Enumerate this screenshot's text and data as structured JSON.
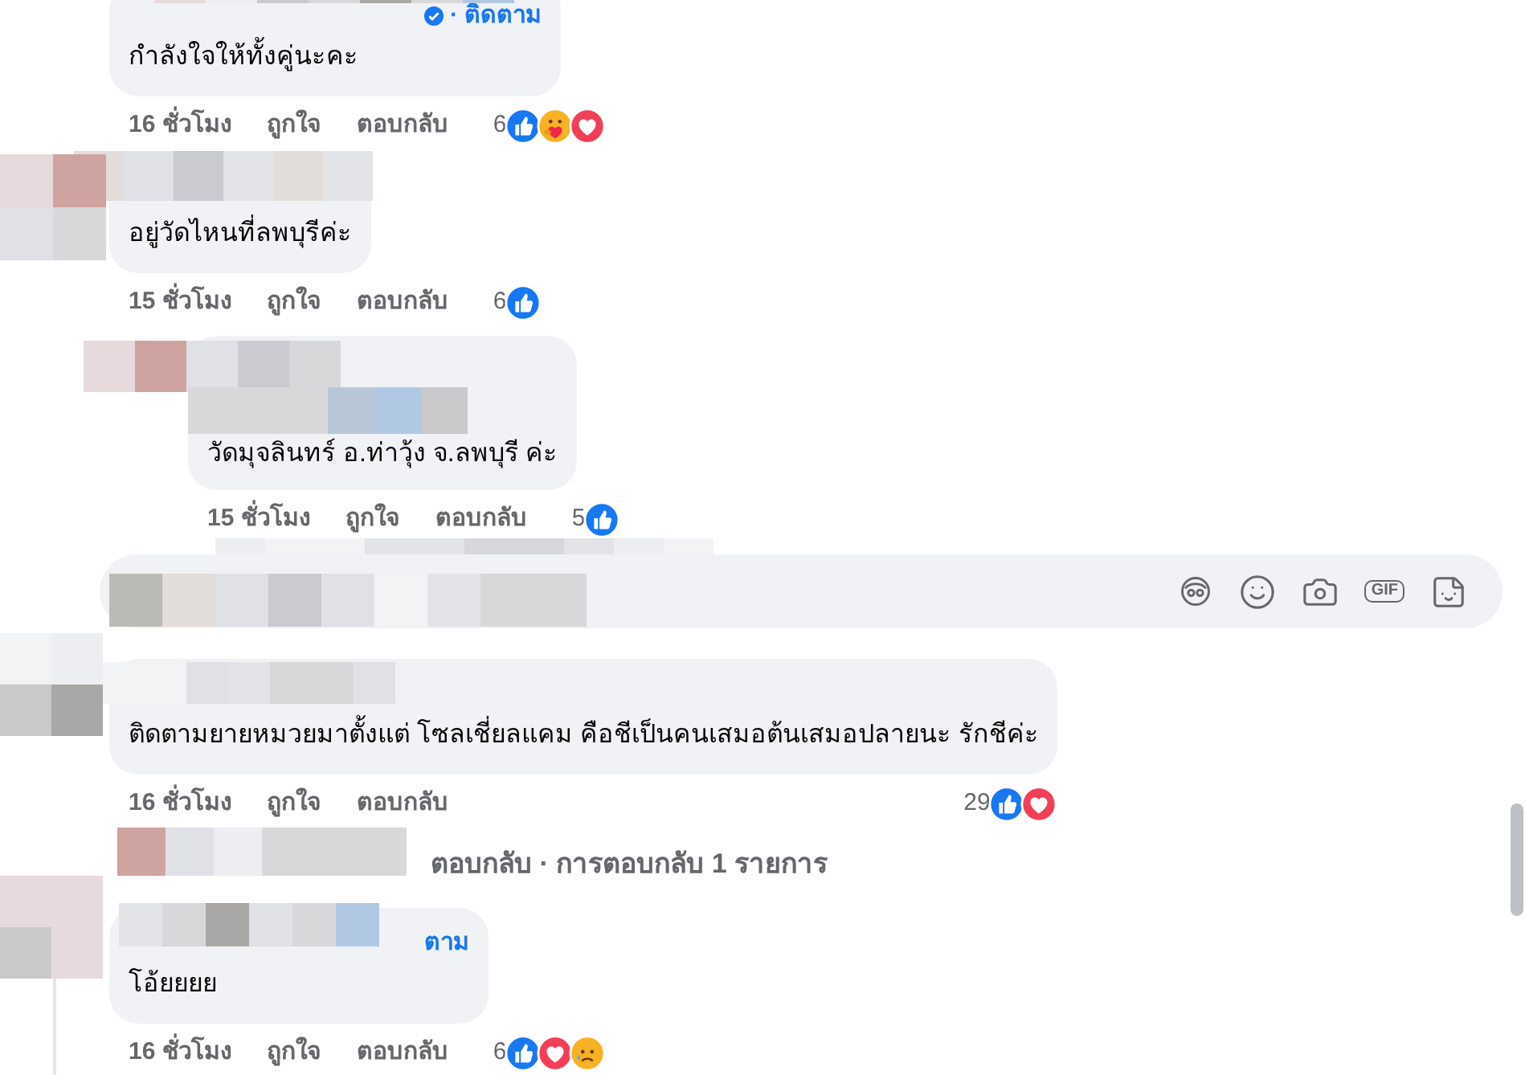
{
  "thread": [
    {
      "kind": "comment",
      "indent": false,
      "header": "· ติดตาม",
      "verified": true,
      "text": "กำลังใจให้ทั้งคู่นะคะ",
      "time": "16 ชั่วโมง",
      "like": "ถูกใจ",
      "reply": "ตอบกลับ",
      "count": "6",
      "reactions": [
        {
          "kind": "like"
        },
        {
          "kind": "care"
        },
        {
          "kind": "love"
        }
      ]
    },
    {
      "kind": "comment",
      "indent": false,
      "text": "อยู่วัดไหนที่ลพบุรีค่ะ",
      "time": "15 ชั่วโมง",
      "like": "ถูกใจ",
      "reply": "ตอบกลับ",
      "count": "6",
      "reactions": [
        {
          "kind": "like"
        }
      ]
    },
    {
      "kind": "comment",
      "indent": true,
      "text": "วัดมุจลินทร์ อ.ท่าวุ้ง จ.ลพบุรี ค่ะ",
      "time": "15 ชั่วโมง",
      "like": "ถูกใจ",
      "reply": "ตอบกลับ",
      "count": "5",
      "reactions": [
        {
          "kind": "like"
        }
      ]
    },
    {
      "kind": "composer",
      "gif_label": "GIF"
    },
    {
      "kind": "comment",
      "indent": false,
      "text": "ติดตามยายหมวยมาตั้งแต่ โซลเชี่ยลแคม คือชีเป็นคนเสมอต้นเสมอปลายนะ รักชีค่ะ",
      "time": "16 ชั่วโมง",
      "like": "ถูกใจ",
      "reply": "ตอบกลับ",
      "count": "29",
      "reactions": [
        {
          "kind": "like"
        },
        {
          "kind": "love"
        }
      ]
    },
    {
      "kind": "replies_link",
      "text": "ตอบกลับ · การตอบกลับ 1 รายการ"
    },
    {
      "kind": "comment",
      "indent": false,
      "header": "ตาม",
      "verified": false,
      "text": "โอ้ยยยย",
      "time": "16 ชั่วโมง",
      "like": "ถูกใจ",
      "reply": "ตอบกลับ",
      "count": "6",
      "reactions": [
        {
          "kind": "like"
        },
        {
          "kind": "love"
        },
        {
          "kind": "sad"
        }
      ]
    }
  ]
}
